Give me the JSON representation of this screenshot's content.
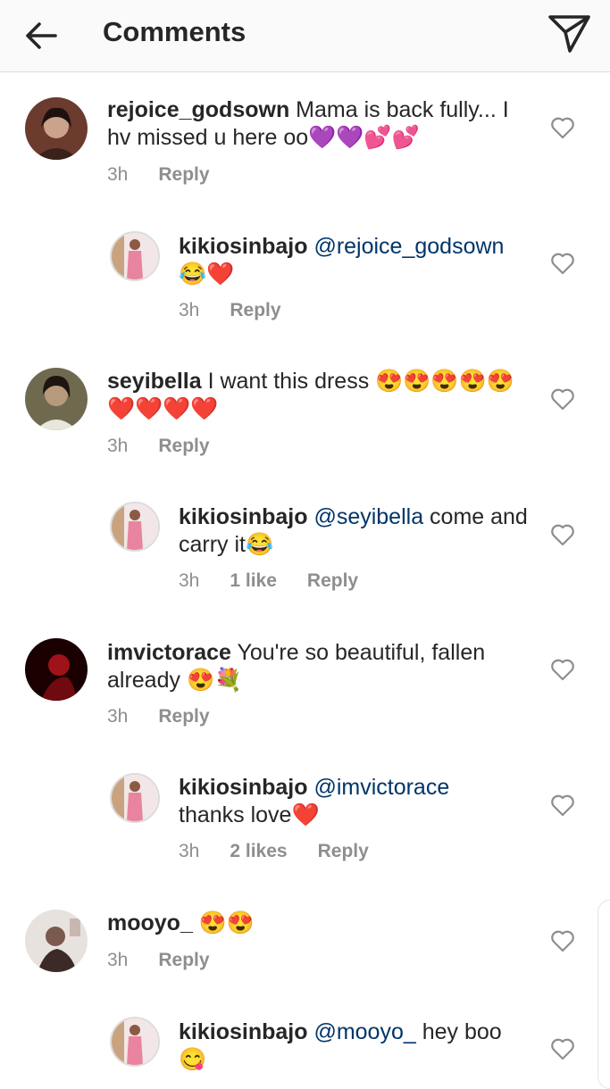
{
  "header": {
    "title": "Comments",
    "back_icon": "arrow-left-icon",
    "send_icon": "paper-plane-icon"
  },
  "comments": [
    {
      "username": "rejoice_godsown",
      "text": " Mama is back fully... I hv missed u here oo💜💜💕💕",
      "time": "3h",
      "reply_label": "Reply",
      "avatar_colors": [
        "#6b3b2e",
        "#caa38a"
      ]
    },
    {
      "username": "kikiosinbajo",
      "mention": "@rejoice_godsown",
      "text": "\n😂❤️",
      "time": "3h",
      "reply_label": "Reply",
      "avatar_colors": [
        "#f0c4d0",
        "#e8849e"
      ]
    },
    {
      "username": "seyibella",
      "text": " I want this dress 😍😍😍😍😍❤️❤️❤️❤️",
      "time": "3h",
      "reply_label": "Reply",
      "avatar_colors": [
        "#3a3a2c",
        "#b79a7c"
      ]
    },
    {
      "username": "kikiosinbajo",
      "mention": "@seyibella",
      "text": " come and carry it😂",
      "time": "3h",
      "likes": "1 like",
      "reply_label": "Reply",
      "avatar_colors": [
        "#f0c4d0",
        "#e8849e"
      ]
    },
    {
      "username": "imvictorace",
      "text": " You're so beautiful, fallen already 😍💐",
      "time": "3h",
      "reply_label": "Reply",
      "avatar_colors": [
        "#2a0204",
        "#a0121a"
      ]
    },
    {
      "username": "kikiosinbajo",
      "mention": "@imvictorace",
      "text": "\nthanks love❤️",
      "time": "3h",
      "likes": "2 likes",
      "reply_label": "Reply",
      "avatar_colors": [
        "#f0c4d0",
        "#e8849e"
      ]
    },
    {
      "username": "mooyo_",
      "text": " 😍😍",
      "time": "3h",
      "reply_label": "Reply",
      "avatar_colors": [
        "#d9d0cc",
        "#7a5a4e"
      ]
    },
    {
      "username": "kikiosinbajo",
      "mention": "@mooyo_",
      "text": " hey boo\n😋",
      "avatar_colors": [
        "#f0c4d0",
        "#e8849e"
      ]
    }
  ],
  "icons": {
    "like": "heart-outline-icon"
  }
}
